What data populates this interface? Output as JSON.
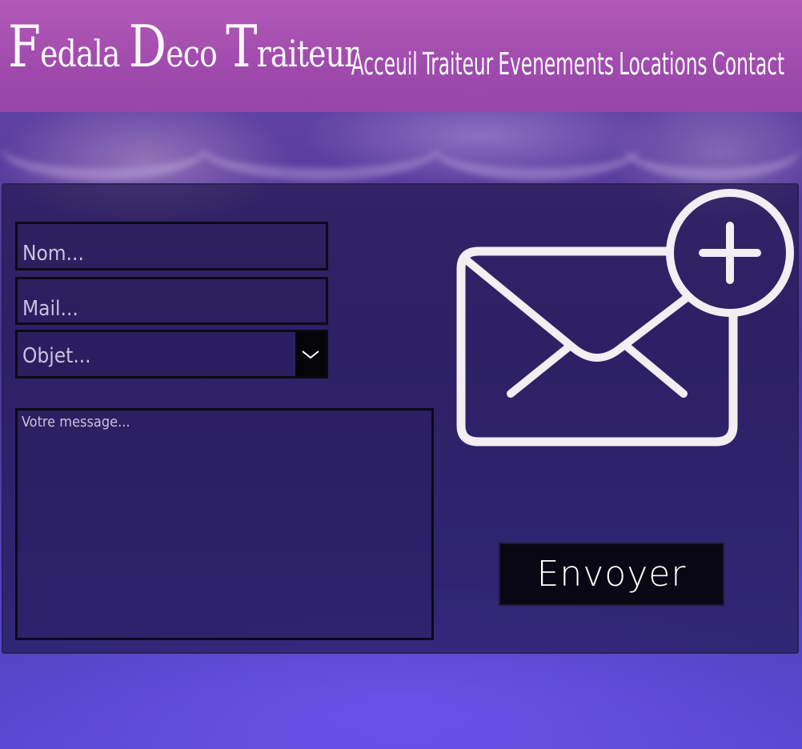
{
  "header": {
    "brand": {
      "word1_initial": "F",
      "word1_rest": "edala",
      "word2_initial": "D",
      "word2_rest": "eco",
      "word3_initial": "T",
      "word3_rest": "raiteur"
    },
    "nav": [
      {
        "label": "Acceuil"
      },
      {
        "label": "Traiteur"
      },
      {
        "label": "Evenements"
      },
      {
        "label": "Locations"
      },
      {
        "label": "Contact"
      }
    ]
  },
  "form": {
    "nom_placeholder": "Nom...",
    "mail_placeholder": "Mail...",
    "objet_selected": "Objet...",
    "message_placeholder": "Votre message...",
    "send_label": "Envoyer"
  },
  "icons": {
    "envelope": "envelope-plus-icon",
    "dropdown": "chevron-down-icon"
  },
  "colors": {
    "header": "#a24cae",
    "panel": "#1c1446",
    "button": "#0a0714",
    "icon": "#f2eef2"
  }
}
